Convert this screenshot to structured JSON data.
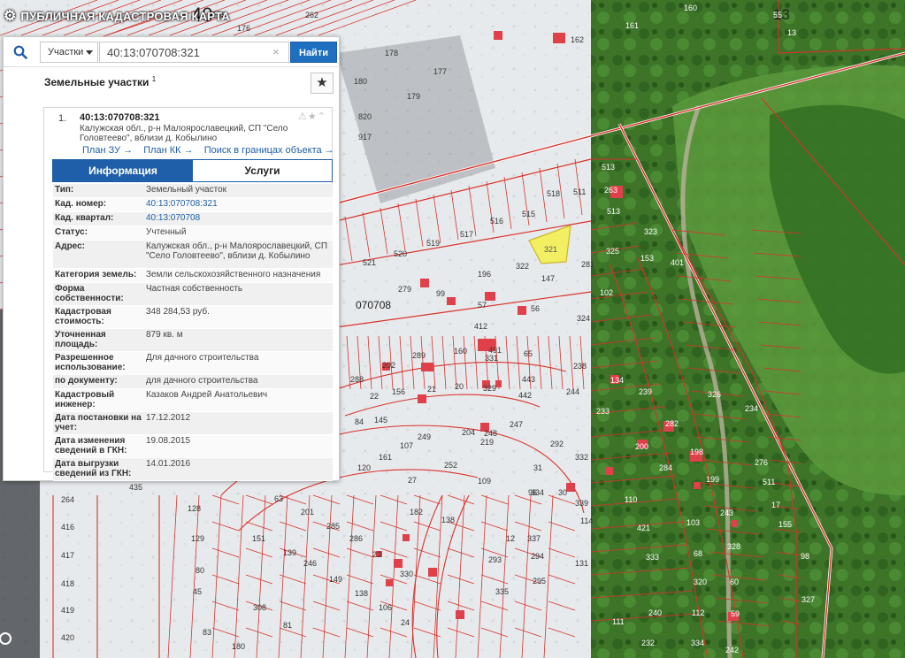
{
  "app": {
    "title": "ПУБЛИЧНАЯ КАДАСТРОВАЯ КАРТА"
  },
  "search": {
    "type_label": "Участки",
    "query": "40:13:070708:321",
    "button_label": "Найти",
    "clear_symbol": "×"
  },
  "results": {
    "section_title": "Земельные участки",
    "count": "1",
    "favorite_symbol": "★"
  },
  "parcel": {
    "index": "1.",
    "cad_number": "40:13:070708:321",
    "address": "Калужская обл., р-н Малоярославецкий, СП \"Село Головтеево\", вблизи д. Кобылино",
    "tool_icons": "⚠★⌃",
    "links": {
      "plan_zu": "План ЗУ →",
      "plan_kk": "План КК →",
      "search_bounds": "Поиск в границах объекта →"
    },
    "tabs": {
      "info": "Информация",
      "services": "Услуги"
    },
    "fields": [
      {
        "key": "Тип:",
        "value": "Земельный участок"
      },
      {
        "key": "Кад. номер:",
        "value": "40:13:070708:321",
        "link": true
      },
      {
        "key": "Кад. квартал:",
        "value": "40:13:070708",
        "link": true
      },
      {
        "key": "Статус:",
        "value": "Учтенный"
      },
      {
        "key": "Адрес:",
        "value": "Калужская обл., р-н Малоярославецкий, СП \"Село Головтеево\", вблизи д. Кобылино"
      },
      {
        "key": "Категория земель:",
        "value": "Земли сельскохозяйственного назначения"
      },
      {
        "key": "Форма собственности:",
        "value": "Частная собственность"
      },
      {
        "key": "Кадастровая стоимость:",
        "value": "348 284,53 руб."
      },
      {
        "key": "Уточненная площадь:",
        "value": "879 кв. м"
      },
      {
        "key": "Разрешенное использование:",
        "value": "Для дачного строительства"
      },
      {
        "key": "по документу:",
        "value": "для дачного строительства"
      },
      {
        "key": "Кадастровый инженер:",
        "value": "Казаков Андрей Анатольевич"
      },
      {
        "key": "Дата постановки на учет:",
        "value": "17.12.2012"
      },
      {
        "key": "Дата изменения сведений в ГКН:",
        "value": "19.08.2015"
      },
      {
        "key": "Дата выгрузки сведений из ГКН:",
        "value": "14.01.2016"
      }
    ]
  },
  "map": {
    "colors": {
      "boundary": "#d8322a",
      "snow": "#e9ecef",
      "forest": "#3f7a2a",
      "selected": "#f3ef62"
    },
    "quarter_labels": [
      "40",
      "13",
      "070708"
    ],
    "parcel_labels": [
      "262",
      "160",
      "161",
      "255",
      "176",
      "162",
      "178",
      "177",
      "179",
      "180",
      "820",
      "917",
      "216",
      "895",
      "520",
      "519",
      "517",
      "516",
      "515",
      "518",
      "511",
      "513",
      "521",
      "279",
      "99",
      "196",
      "322",
      "147",
      "57",
      "56",
      "412",
      "324",
      "281",
      "102",
      "323",
      "325",
      "153",
      "401",
      "289",
      "491",
      "331",
      "160",
      "65",
      "238",
      "202",
      "21",
      "20",
      "329",
      "443",
      "442",
      "244",
      "156",
      "288",
      "22",
      "84",
      "145",
      "219",
      "247",
      "248",
      "204",
      "249",
      "107",
      "161",
      "120",
      "252",
      "109",
      "292",
      "332",
      "27",
      "96",
      "63",
      "182",
      "201",
      "285",
      "286",
      "23",
      "330",
      "151",
      "139",
      "246",
      "149",
      "138",
      "106",
      "24",
      "435",
      "128",
      "129",
      "80",
      "45",
      "308",
      "81",
      "83",
      "180",
      "264",
      "416",
      "417",
      "418",
      "419",
      "420",
      "421",
      "333",
      "110",
      "68",
      "328",
      "103",
      "243",
      "155",
      "320",
      "60",
      "240",
      "111",
      "112",
      "59",
      "327",
      "232",
      "334",
      "242",
      "282",
      "198",
      "199",
      "134",
      "239",
      "326",
      "234",
      "233",
      "200",
      "284",
      "263",
      "513",
      "511",
      "17",
      "276",
      "98",
      "55",
      "13",
      "12",
      "337",
      "294",
      "295",
      "293",
      "335",
      "334",
      "31",
      "30",
      "339",
      "114",
      "131",
      "138"
    ],
    "selected_parcel_label": "321"
  }
}
